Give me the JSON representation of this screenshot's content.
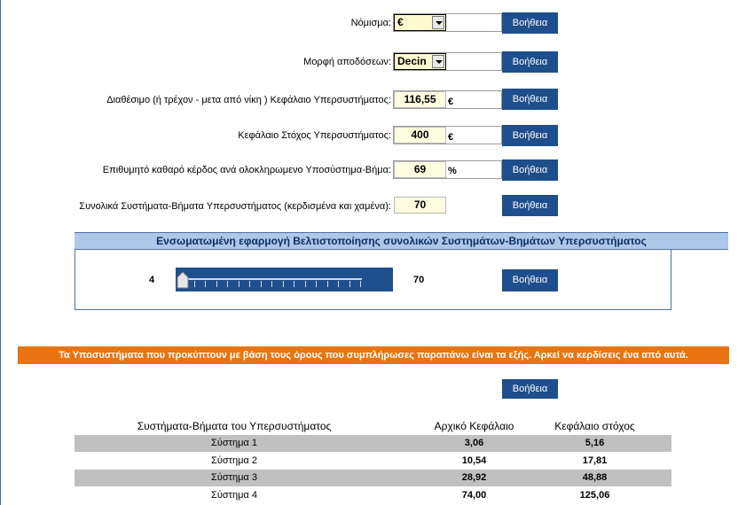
{
  "form": {
    "currency": {
      "label": "Νόμισμα:",
      "value": "€",
      "help": "Βοήθεια"
    },
    "odds_format": {
      "label": "Μορφή αποδόσεων:",
      "value": "Decin",
      "help": "Βοήθεια"
    },
    "available_capital": {
      "label": "Διαθέσιμο (ή τρέχον - μετα από νίκη ) Κεφάλαιο Υπερσυστήματος:",
      "value": "116,55",
      "unit": "€",
      "help": "Βοήθεια"
    },
    "target_capital": {
      "label": "Κεφάλαιο Στόχος Υπερσυστήματος:",
      "value": "400",
      "unit": "€",
      "help": "Βοήθεια"
    },
    "desired_profit": {
      "label": "Επιθυμητό καθαρό κέρδος ανά ολοκληρωμενο Υποσύστημα-Βήμα:",
      "value": "69",
      "unit": "%",
      "help": "Βοήθεια"
    },
    "total_systems": {
      "label": "Συνολικά Συστήματα-Βήματα Υπερσυστήματος (κερδισμένα και χαμένα):",
      "value": "70",
      "help": "Βοήθεια"
    }
  },
  "optimizer": {
    "title": "Ενσωματωμένη εφαρμογή Βελτιστοποίησης συνολικών Συστημάτων-Βημάτων Υπερσυστήματος",
    "min": "4",
    "max": "70",
    "help": "Βοήθεια"
  },
  "results": {
    "banner": "Τα Υποσυστήματα που προκύπτουν με βάση τους όρους που συμπλήρωσες παραπάνω είναι τα εξής. Αρκεί να κερδίσεις ένα από αυτά.",
    "help": "Βοήθεια",
    "headers": [
      "Συστήματα-Βήματα του Υπερσυστήματος",
      "Αρχικό Κεφάλαιο",
      "Κεφάλαιο στόχος"
    ],
    "rows": [
      {
        "name": "Σύστημα 1",
        "initial": "3,06",
        "target": "5,16"
      },
      {
        "name": "Σύστημα 2",
        "initial": "10,54",
        "target": "17,81"
      },
      {
        "name": "Σύστημα 3",
        "initial": "28,92",
        "target": "48,88"
      },
      {
        "name": "Σύστημα 4",
        "initial": "74,00",
        "target": "125,06"
      }
    ]
  },
  "colors": {
    "help_button": "#1f4e8c",
    "banner": "#e87511",
    "panel_header": "#aec6e8",
    "row_shade": "#c0c0c0"
  }
}
